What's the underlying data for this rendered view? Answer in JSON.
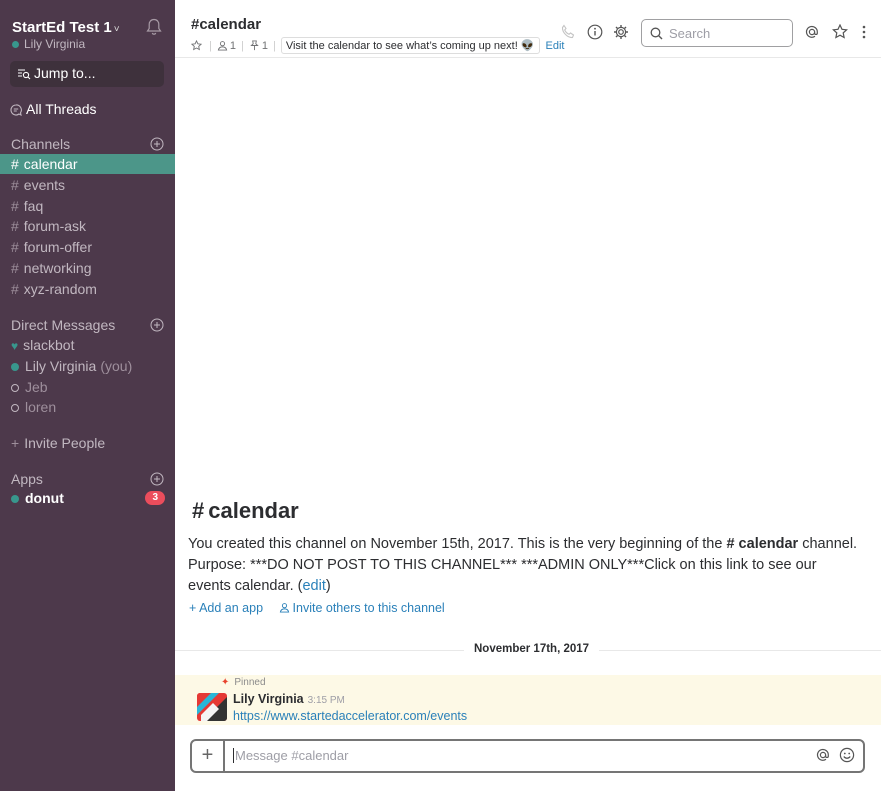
{
  "sidebar": {
    "team_name": "StartEd  Test 1",
    "team_caret": "˅",
    "user_name": "Lily Virginia",
    "jump_to": "Jump to...",
    "all_threads": "All Threads",
    "channels_header": "Channels",
    "channels": [
      {
        "name": "calendar",
        "active": true
      },
      {
        "name": "events",
        "active": false
      },
      {
        "name": "faq",
        "active": false
      },
      {
        "name": "forum-ask",
        "active": false
      },
      {
        "name": "forum-offer",
        "active": false
      },
      {
        "name": "networking",
        "active": false
      },
      {
        "name": "xyz-random",
        "active": false
      }
    ],
    "dm_header": "Direct Messages",
    "dms": [
      {
        "name": "slackbot",
        "suffix": ""
      },
      {
        "name": "Lily Virginia",
        "suffix": "(you)"
      },
      {
        "name": "Jeb",
        "suffix": ""
      },
      {
        "name": "loren",
        "suffix": ""
      }
    ],
    "invite": "Invite People",
    "apps_header": "Apps",
    "apps": [
      {
        "name": "donut",
        "badge": "3"
      }
    ]
  },
  "header": {
    "channel_name": "#calendar",
    "members_count": "1",
    "pinned_count": "1",
    "topic": "Visit the calendar to see what’s coming up next! 👽",
    "edit": "Edit",
    "search_placeholder": "Search"
  },
  "intro": {
    "title": "calendar",
    "hash": "#",
    "text_before": "You created this channel on November 15th, 2017. This is the very beginning of the ",
    "channel_bold": "# calendar",
    "text_after": " channel. Purpose: ***DO NOT POST TO THIS CHANNEL*** ***ADMIN ONLY***Click on this link to see our events calendar. (",
    "edit_link": "edit",
    "close_paren": ")",
    "add_app": "Add an app",
    "invite_others": "Invite others to this channel"
  },
  "divider_date": "November 17th, 2017",
  "message": {
    "pinned_label": "Pinned",
    "sender": "Lily Virginia",
    "time": "3:15 PM",
    "link": "https://www.startedaccelerator.com/events"
  },
  "composer": {
    "placeholder": "Message #calendar",
    "plus": "+"
  },
  "colors": {
    "sidebar_bg": "#4d394b",
    "active_channel": "#4c9689",
    "link": "#2a80b9",
    "badge": "#eb4d5c",
    "pinned_bg": "#fdf9e6"
  }
}
